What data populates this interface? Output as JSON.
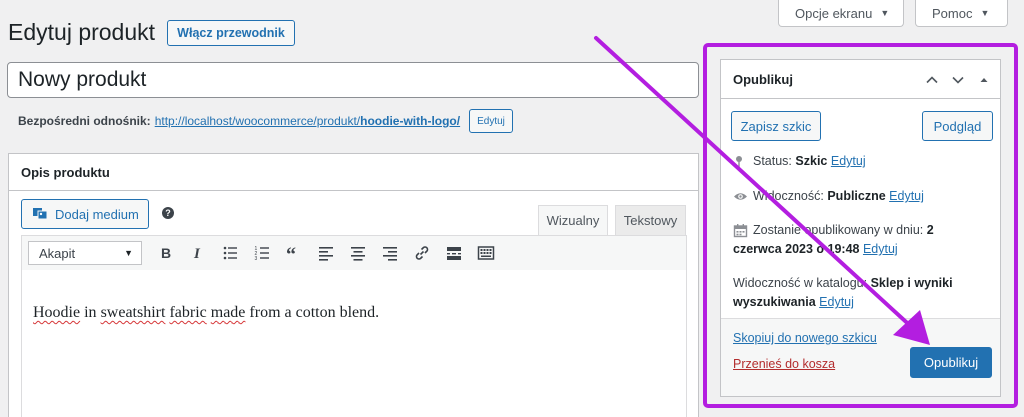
{
  "header": {
    "screen_options_label": "Opcje ekranu",
    "help_label": "Pomoc",
    "page_title": "Edytuj produkt",
    "guide_button_label": "Włącz przewodnik"
  },
  "product": {
    "title_value": "Nowy produkt",
    "permalink_label": "Bezpośredni odnośnik:",
    "permalink_url_base": "http://localhost/woocommerce/produkt/",
    "permalink_slug": "hoodie-with-logo/",
    "permalink_edit_label": "Edytuj"
  },
  "description": {
    "panel_title": "Opis produktu",
    "add_media_label": "Dodaj medium",
    "tab_visual": "Wizualny",
    "tab_text": "Tekstowy",
    "format_select_value": "Akapit",
    "content_words": [
      "Hoodie",
      " in ",
      "sweatshirt",
      " ",
      "fabric",
      " ",
      "made",
      " from a cotton blend."
    ]
  },
  "publish": {
    "panel_title": "Opublikuj",
    "save_draft_label": "Zapisz szkic",
    "preview_label": "Podgląd",
    "status_label": "Status:",
    "status_value": "Szkic",
    "status_edit": "Edytuj",
    "visibility_label": "Widoczność:",
    "visibility_value": "Publiczne",
    "visibility_edit": "Edytuj",
    "schedule_label": "Zostanie opublikowany w dniu:",
    "schedule_value_line1": "2",
    "schedule_value_line2": "czerwca 2023 o 19:48",
    "schedule_edit": "Edytuj",
    "catalog_label": "Widoczność w katalogu:",
    "catalog_value_line1": "Sklep i wyniki",
    "catalog_value_line2": "wyszukiwania",
    "catalog_edit": "Edytuj",
    "copy_draft_label": "Skopiuj do nowego szkicu",
    "trash_label": "Przenieś do kosza",
    "publish_button_label": "Opublikuj"
  },
  "colors": {
    "accent": "#2271b1",
    "annotation": "#b31ee0",
    "trash": "#b32d2e"
  }
}
